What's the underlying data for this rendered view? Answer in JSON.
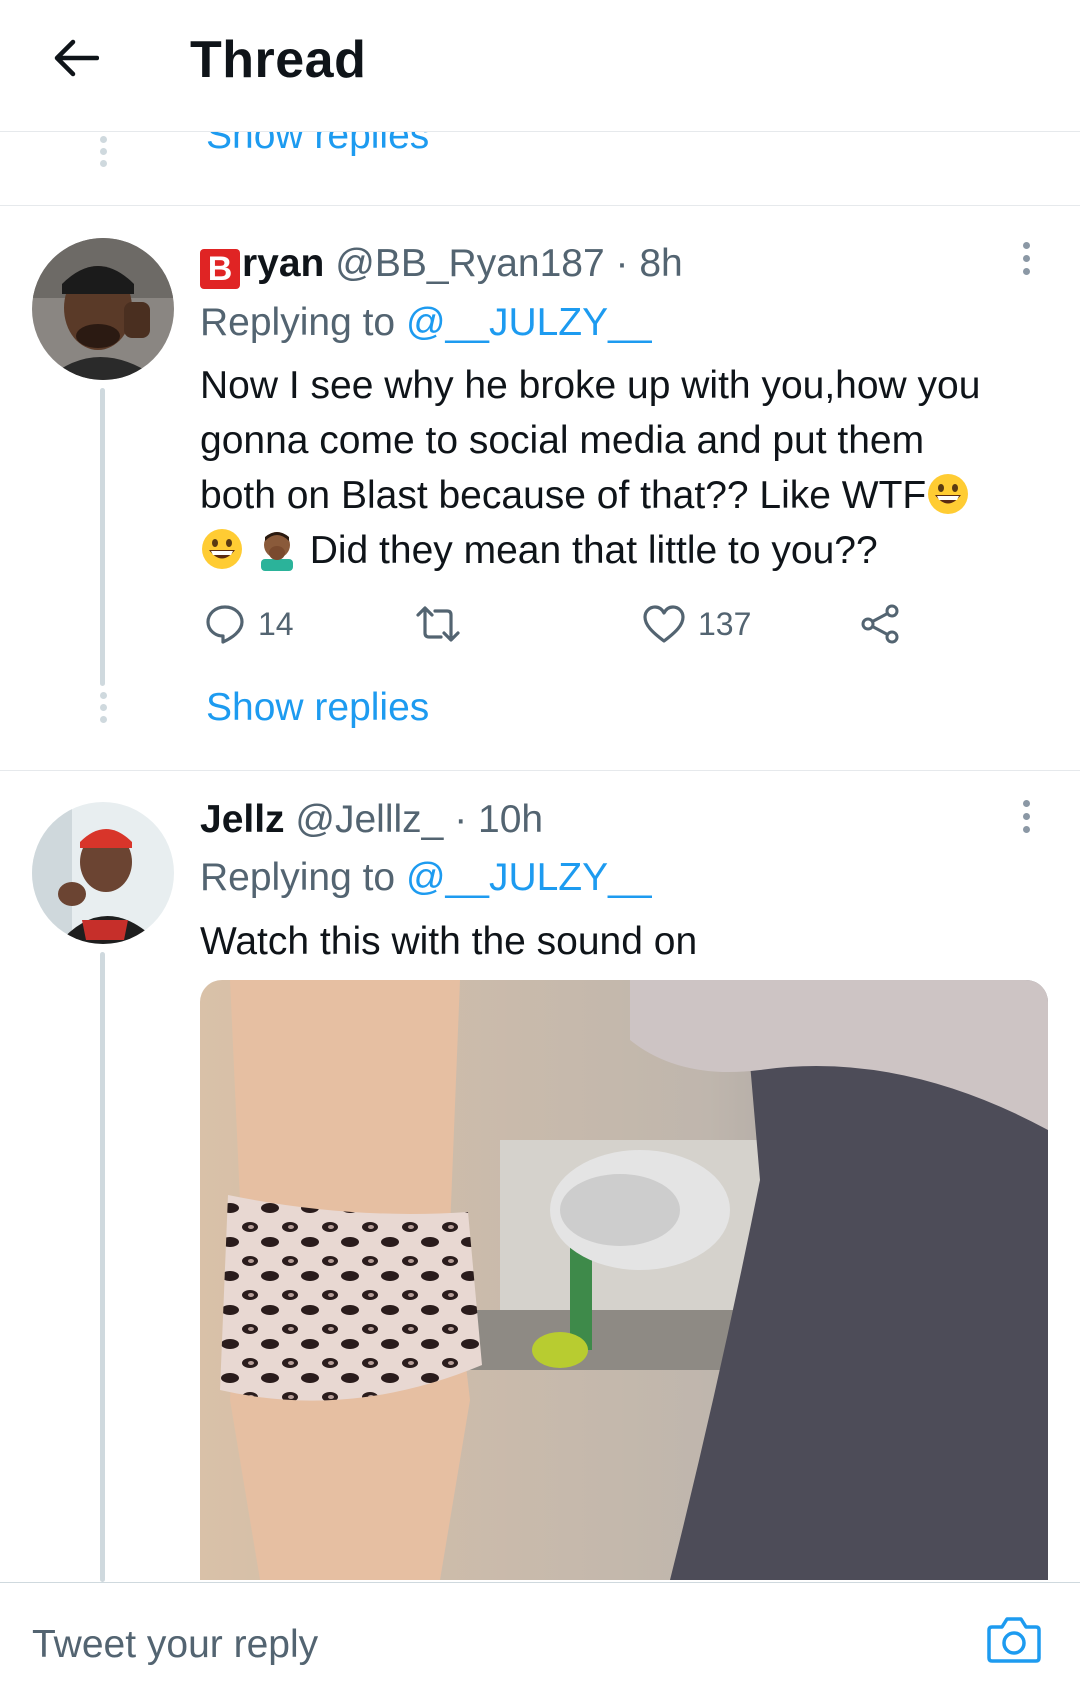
{
  "header": {
    "title": "Thread",
    "back_icon": "arrow-left-icon"
  },
  "top_section": {
    "show_replies": "Show replies"
  },
  "tweets": [
    {
      "display_name": "ryan",
      "name_prefix_emoji": "B",
      "handle": "@BB_Ryan187",
      "time": " · 8h",
      "replying_label": "Replying to",
      "replying_to": "@__JULZY__",
      "text_line1": "Now I see why he broke up with you,how you",
      "text_line2": "gonna come to social media and put them",
      "text_line3": "both on Blast because of that?? Like WTF",
      "text_line4": "Did they mean that little to you??",
      "reply_count": "14",
      "retweet_count": "",
      "like_count": "137",
      "show_replies": "Show replies"
    },
    {
      "display_name": "Jellz",
      "handle": "@Jelllz_",
      "time": " · 10h",
      "replying_label": "Replying to",
      "replying_to": "@__JULZY__",
      "text": "Watch this with the sound on"
    }
  ],
  "composer": {
    "placeholder": "Tweet your reply",
    "camera_icon": "camera-icon"
  },
  "colors": {
    "accent": "#1d9bf0",
    "secondary_text": "#536471",
    "primary_text": "#0f1419",
    "divider": "#e6e9ec"
  }
}
